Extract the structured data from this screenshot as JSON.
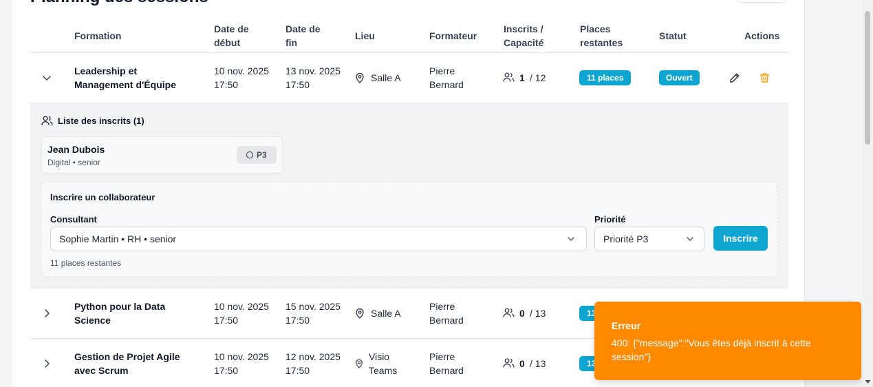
{
  "page": {
    "title": "Planning des sessions"
  },
  "table": {
    "headers": {
      "formation": "Formation",
      "date_debut": "Date de début",
      "date_fin": "Date de fin",
      "lieu": "Lieu",
      "formateur": "Formateur",
      "inscrits": "Inscrits / Capacité",
      "places": "Places restantes",
      "statut": "Statut",
      "actions": "Actions"
    },
    "rows": [
      {
        "formation": "Leadership et Management d'Équipe",
        "debut": "10 nov. 2025 17:50",
        "fin": "13 nov. 2025 17:50",
        "lieu": "Salle A",
        "formateur": "Pierre Bernard",
        "inscrits": "1",
        "capacite": "/ 12",
        "places": "11 places",
        "statut": "Ouvert"
      },
      {
        "formation": "Python pour la Data Science",
        "debut": "10 nov. 2025 17:50",
        "fin": "15 nov. 2025 17:50",
        "lieu": "Salle A",
        "formateur": "Pierre Bernard",
        "inscrits": "0",
        "capacite": "/ 13",
        "places": "13"
      },
      {
        "formation": "Gestion de Projet Agile avec Scrum",
        "debut": "10 nov. 2025 17:50",
        "fin": "12 nov. 2025 17:50",
        "lieu": "Visio Teams",
        "formateur": "Pierre Bernard",
        "inscrits": "0",
        "capacite": "/ 13",
        "places": "13"
      }
    ]
  },
  "inscrits_panel": {
    "title": "Liste des inscrits (1)",
    "entries": [
      {
        "name": "Jean Dubois",
        "meta": "Digital • senior",
        "priority": "P3"
      }
    ]
  },
  "inscription_form": {
    "title": "Inscrire un collaborateur",
    "consultant_label": "Consultant",
    "consultant_value": "Sophie Martin • RH • senior",
    "priorite_label": "Priorité",
    "priorite_value": "Priorité P3",
    "submit_label": "Inscrire",
    "remaining": "11 places restantes"
  },
  "toast": {
    "title": "Erreur",
    "message": "400: {\"message\":\"Vous êtes déjà inscrit à cette session\"}"
  },
  "colors": {
    "accent": "#0ea5d0",
    "toast": "#ff8a00",
    "delete": "#f59e0b"
  }
}
